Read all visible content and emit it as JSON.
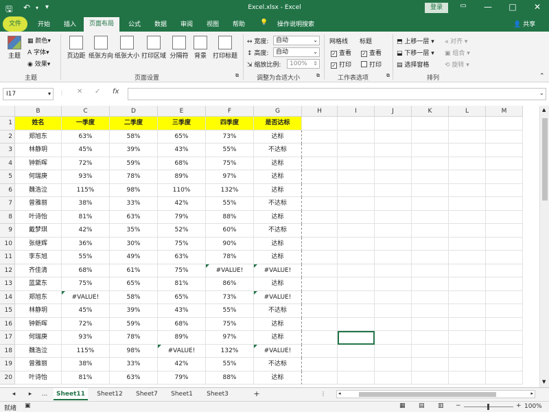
{
  "window": {
    "title": "Excel.xlsx  -  Excel",
    "login": "登录",
    "minimize": "—",
    "restore": "□",
    "maximize": "☐",
    "close": "✕"
  },
  "tabs": {
    "file": "文件",
    "home": "开始",
    "insert": "插入",
    "layout": "页面布局",
    "formula": "公式",
    "data": "数据",
    "review": "审阅",
    "view": "视图",
    "help": "帮助",
    "search": "操作说明搜索",
    "share": "共享"
  },
  "ribbon": {
    "themes": {
      "theme": "主题",
      "colors": "颜色",
      "fonts": "字体",
      "effects": "效果",
      "group": "主题"
    },
    "page_setup": {
      "margins": "页边距",
      "orientation": "纸张方向",
      "size": "纸张大小",
      "print_area": "打印区域",
      "breaks": "分隔符",
      "background": "背景",
      "print_titles": "打印标题",
      "group": "页面设置"
    },
    "scale": {
      "width_label": "宽度:",
      "width_value": "自动",
      "height_label": "高度:",
      "height_value": "自动",
      "scale_label": "缩放比例:",
      "scale_value": "100%",
      "group": "调整为合适大小"
    },
    "sheet_options": {
      "gridlines": "网格线",
      "headings": "标题",
      "view": "查看",
      "print": "打印",
      "view2": "查看",
      "print2": "打印",
      "group": "工作表选项"
    },
    "arrange": {
      "bring_forward": "上移一层",
      "send_backward": "下移一层",
      "selection_pane": "选择窗格",
      "align": "对齐",
      "group_btn": "组合",
      "rotate": "旋转",
      "group": "排列"
    }
  },
  "formula_bar": {
    "name_box": "I17",
    "cancel": "✕",
    "enter": "✓",
    "fx": "fx",
    "value": ""
  },
  "columns": [
    "B",
    "C",
    "D",
    "E",
    "F",
    "G",
    "H",
    "I",
    "J",
    "K",
    "L",
    "M"
  ],
  "rows_numbers": [
    "1",
    "2",
    "3",
    "4",
    "5",
    "6",
    "7",
    "8",
    "9",
    "10",
    "11",
    "12",
    "13",
    "14",
    "15",
    "16",
    "17",
    "18",
    "19",
    "20"
  ],
  "table_header": [
    "姓名",
    "一季度",
    "二季度",
    "三季度",
    "四季度",
    "是否达标"
  ],
  "table_rows": [
    [
      "郑旭东",
      "63%",
      "58%",
      "65%",
      "73%",
      "达标"
    ],
    [
      "林静玥",
      "45%",
      "39%",
      "43%",
      "55%",
      "不达标"
    ],
    [
      "钟新晖",
      "72%",
      "59%",
      "68%",
      "75%",
      "达标"
    ],
    [
      "何瑞庚",
      "93%",
      "78%",
      "89%",
      "97%",
      "达标"
    ],
    [
      "魏浩泣",
      "115%",
      "98%",
      "110%",
      "132%",
      "达标"
    ],
    [
      "曾雅丽",
      "38%",
      "33%",
      "42%",
      "55%",
      "不达标"
    ],
    [
      "叶诗怡",
      "81%",
      "63%",
      "79%",
      "88%",
      "达标"
    ],
    [
      "戴梦琪",
      "42%",
      "35%",
      "52%",
      "60%",
      "不达标"
    ],
    [
      "张继辉",
      "36%",
      "30%",
      "75%",
      "90%",
      "达标"
    ],
    [
      "李东旭",
      "55%",
      "49%",
      "63%",
      "78%",
      "达标"
    ],
    [
      "齐佳清",
      "68%",
      "61%",
      "75%",
      "#VALUE!",
      "#VALUE!"
    ],
    [
      "蓝黛东",
      "75%",
      "65%",
      "81%",
      "86%",
      "达标"
    ],
    [
      "郑旭东",
      "#VALUE!",
      "58%",
      "65%",
      "73%",
      "#VALUE!"
    ],
    [
      "林静玥",
      "45%",
      "39%",
      "43%",
      "55%",
      "不达标"
    ],
    [
      "钟新晖",
      "72%",
      "59%",
      "68%",
      "75%",
      "达标"
    ],
    [
      "何瑞庚",
      "93%",
      "78%",
      "89%",
      "97%",
      "达标"
    ],
    [
      "魏浩泣",
      "115%",
      "98%",
      "#VALUE!",
      "132%",
      "#VALUE!"
    ],
    [
      "曾雅丽",
      "38%",
      "33%",
      "42%",
      "55%",
      "不达标"
    ],
    [
      "叶诗怡",
      "81%",
      "63%",
      "79%",
      "88%",
      "达标"
    ]
  ],
  "sheets": {
    "more": "...",
    "s1": "Sheet11",
    "s2": "Sheet12",
    "s3": "Sheet7",
    "s4": "Sheet1",
    "s5": "Sheet3",
    "add": "+"
  },
  "status": {
    "ready": "就绪",
    "zoom": "100%"
  },
  "colors": {
    "accent": "#217346",
    "header_fill": "#ffff00"
  }
}
